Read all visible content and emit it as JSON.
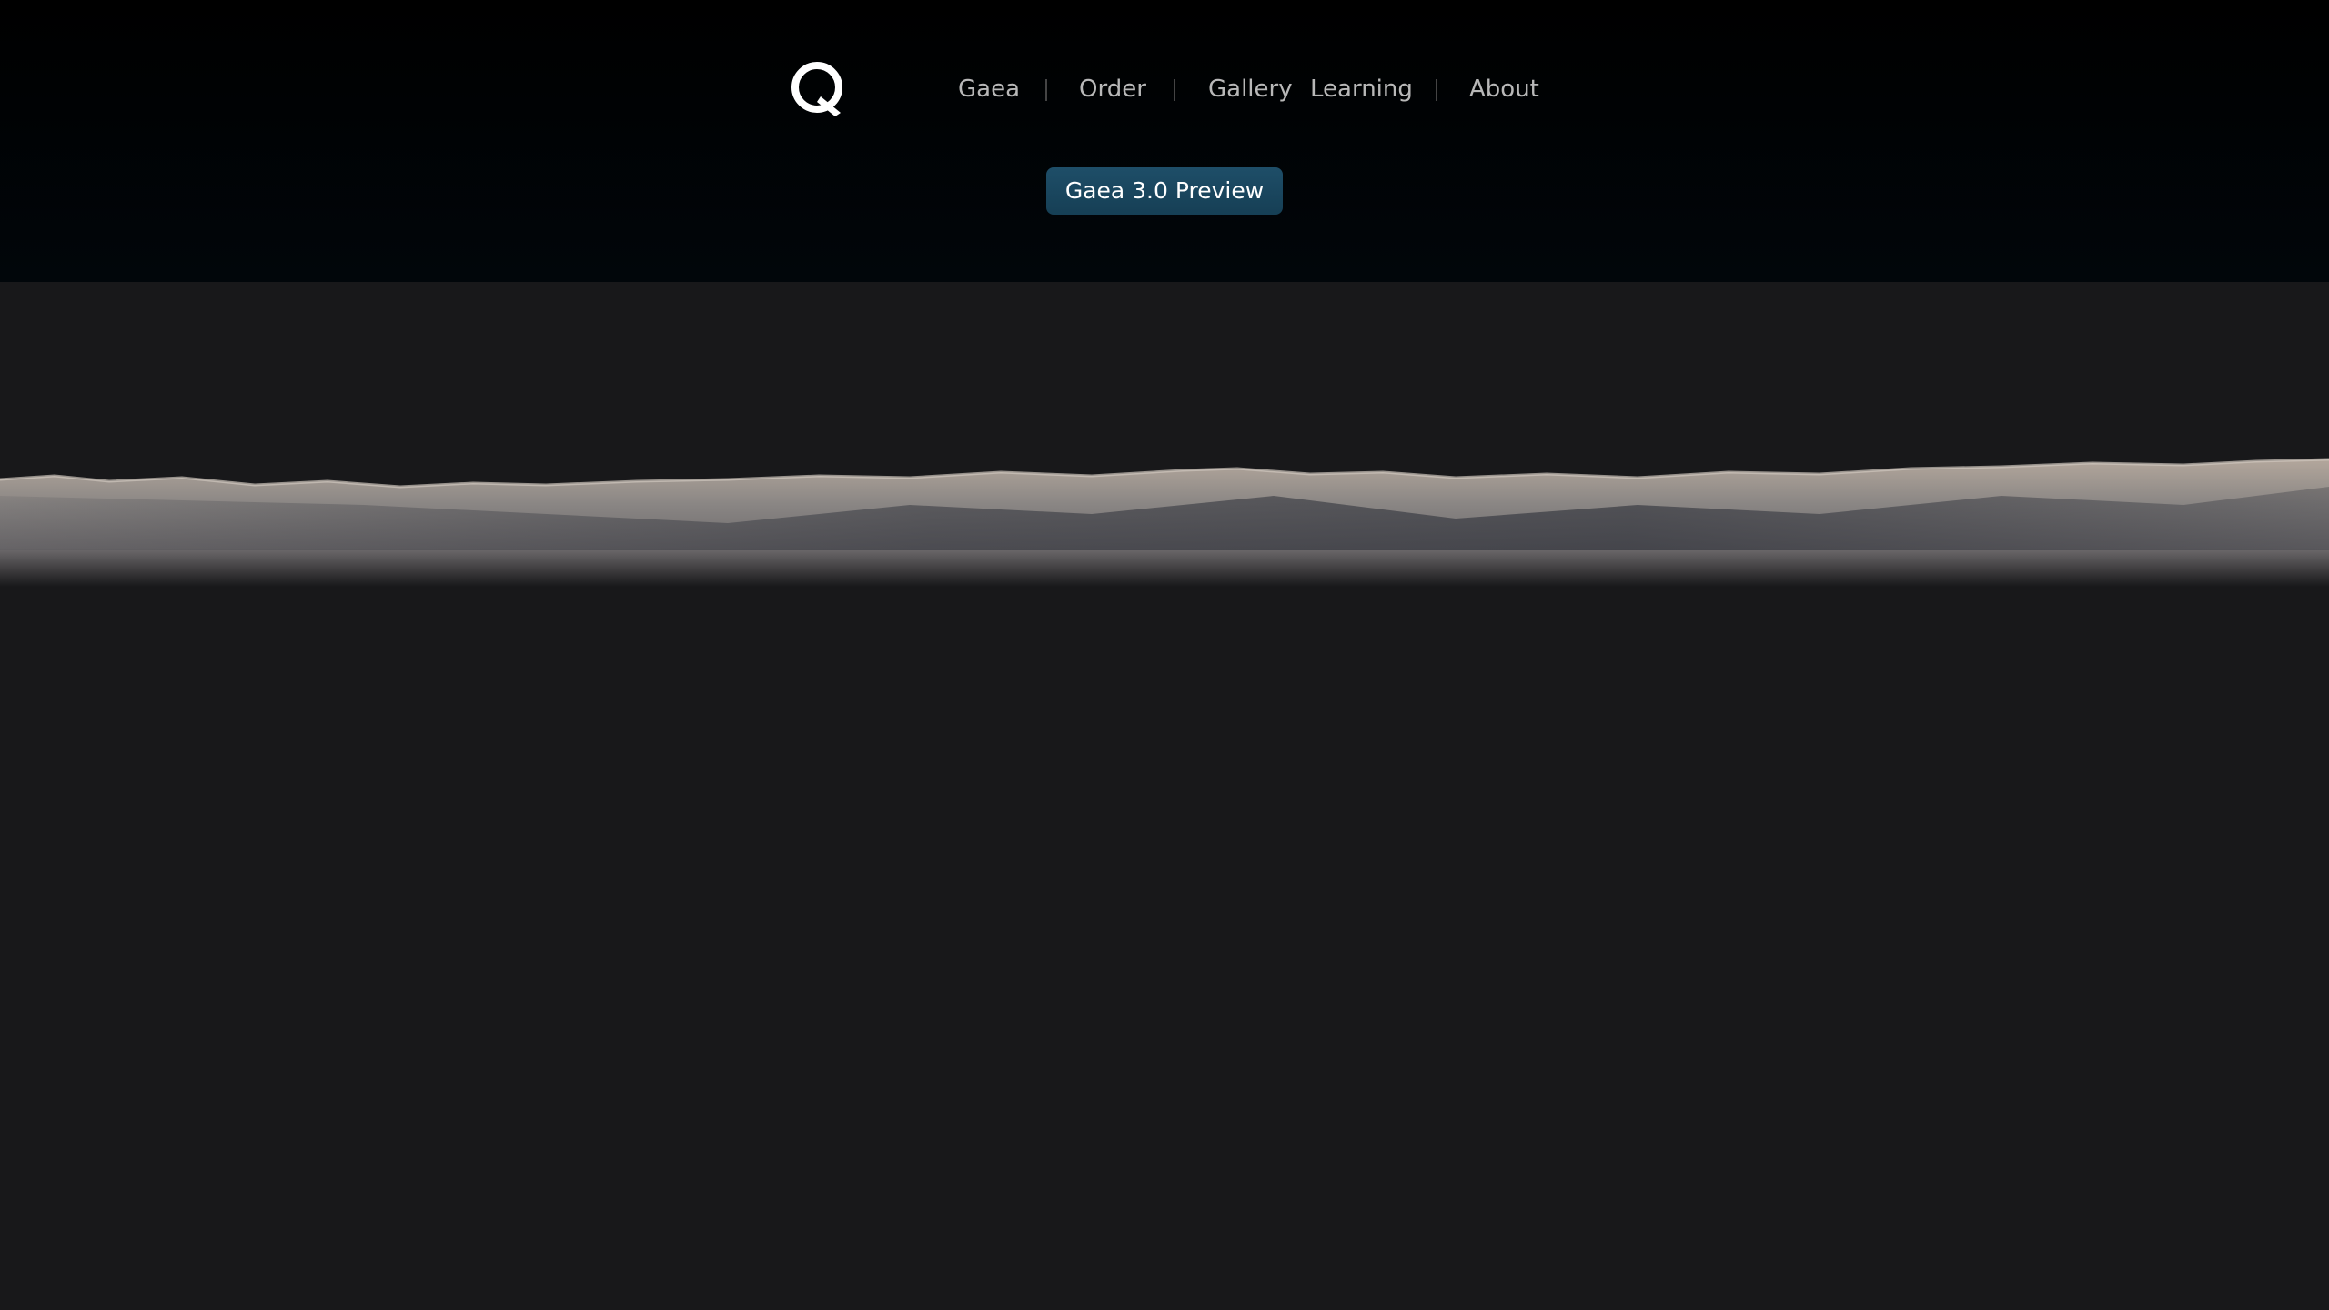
{
  "header": {
    "logo_icon": "q-logo-icon",
    "nav": [
      {
        "label": "Gaea"
      },
      {
        "label": "Order"
      },
      {
        "label": "Gallery"
      },
      {
        "label": "Learning"
      },
      {
        "label": "About"
      }
    ],
    "cta_label": "Gaea 3.0 Preview"
  },
  "colors": {
    "page_background": "#18181a",
    "header_background": "#000000",
    "button_background": "#1b475f",
    "nav_text": "#b8b8b8"
  },
  "hero": {
    "image": "terrain-landscape"
  }
}
